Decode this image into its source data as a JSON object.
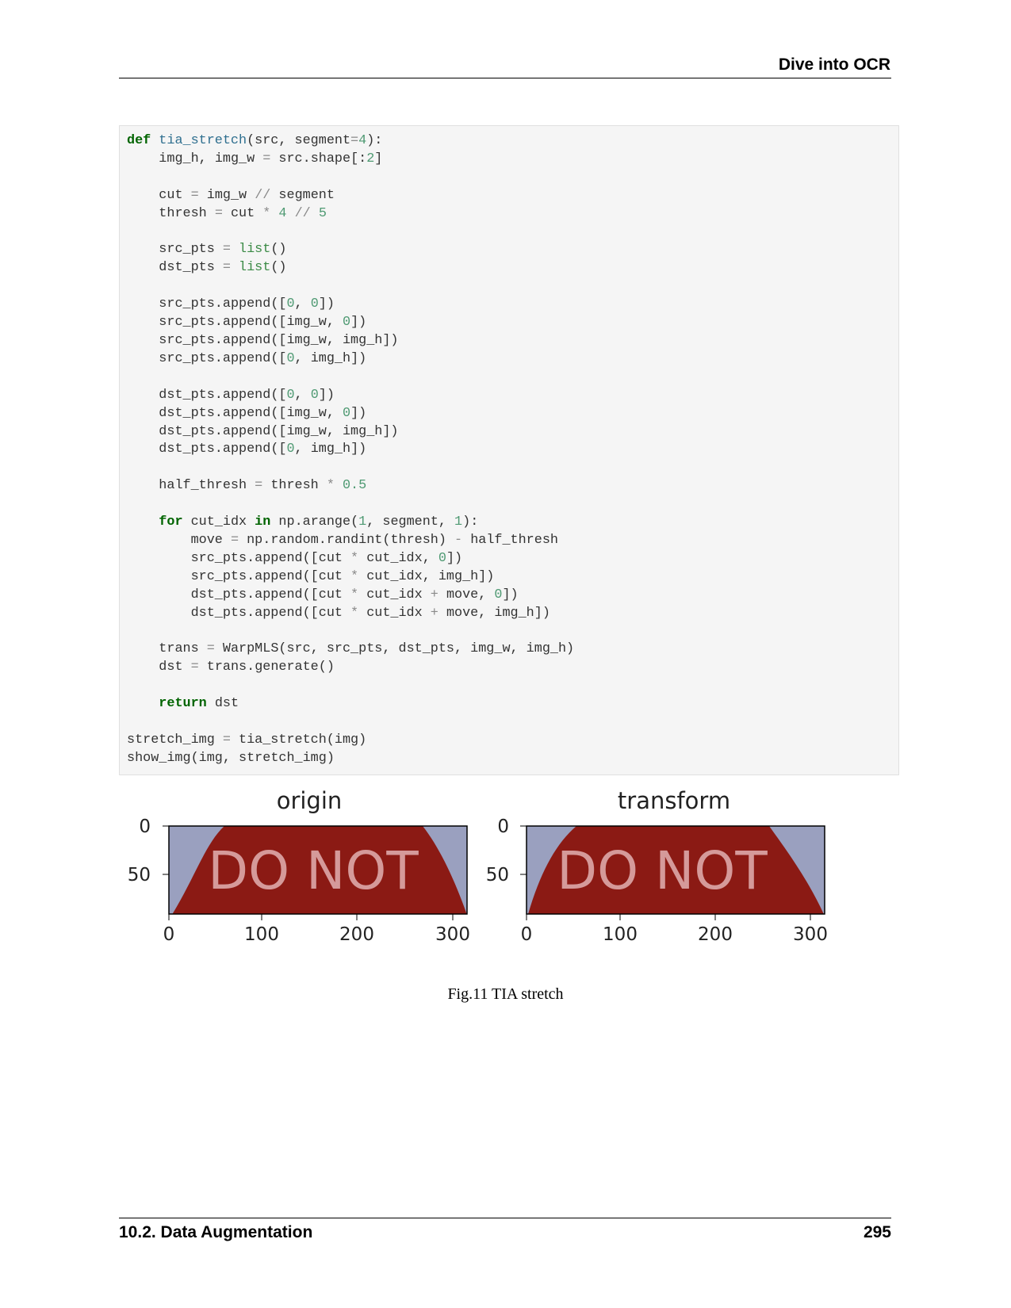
{
  "header": {
    "title": "Dive into OCR"
  },
  "code": {
    "lines": [
      "def tia_stretch(src, segment=4):",
      "    img_h, img_w = src.shape[:2]",
      "",
      "    cut = img_w // segment",
      "    thresh = cut * 4 // 5",
      "",
      "    src_pts = list()",
      "    dst_pts = list()",
      "",
      "    src_pts.append([0, 0])",
      "    src_pts.append([img_w, 0])",
      "    src_pts.append([img_w, img_h])",
      "    src_pts.append([0, img_h])",
      "",
      "    dst_pts.append([0, 0])",
      "    dst_pts.append([img_w, 0])",
      "    dst_pts.append([img_w, img_h])",
      "    dst_pts.append([0, img_h])",
      "",
      "    half_thresh = thresh * 0.5",
      "",
      "    for cut_idx in np.arange(1, segment, 1):",
      "        move = np.random.randint(thresh) - half_thresh",
      "        src_pts.append([cut * cut_idx, 0])",
      "        src_pts.append([cut * cut_idx, img_h])",
      "        dst_pts.append([cut * cut_idx + move, 0])",
      "        dst_pts.append([cut * cut_idx + move, img_h])",
      "",
      "    trans = WarpMLS(src, src_pts, dst_pts, img_w, img_h)",
      "    dst = trans.generate()",
      "",
      "    return dst",
      "",
      "stretch_img = tia_stretch(img)",
      "show_img(img, stretch_img)"
    ]
  },
  "figure": {
    "panels": [
      {
        "title": "origin",
        "sign_text": "DO NOT",
        "x_ticks": [
          "0",
          "100",
          "200",
          "300"
        ],
        "y_ticks": [
          "0",
          "50"
        ]
      },
      {
        "title": "transform",
        "sign_text": "DO NOT",
        "x_ticks": [
          "0",
          "100",
          "200",
          "300"
        ],
        "y_ticks": [
          "0",
          "50"
        ]
      }
    ],
    "caption": "Fig.11 TIA stretch"
  },
  "footer": {
    "section": "10.2.  Data Augmentation",
    "page": "295"
  },
  "colors": {
    "sign_red": "#8b1a14",
    "sign_bg": "#9aa0bf",
    "code_bg": "#f5f5f5"
  }
}
